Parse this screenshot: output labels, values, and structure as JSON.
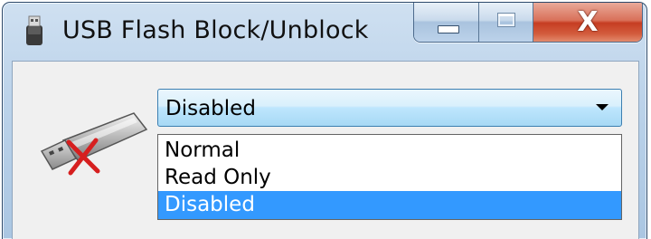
{
  "window": {
    "title": "USB Flash Block/Unblock",
    "controls": {
      "minimize_icon": "minimize-icon",
      "maximize_icon": "maximize-icon",
      "close_label": "X"
    }
  },
  "combo": {
    "selected_value": "Disabled",
    "options": [
      "Normal",
      "Read Only",
      "Disabled"
    ],
    "highlighted_option": "Disabled"
  },
  "colors": {
    "selection": "#3399ff",
    "close_button": "#c63d22",
    "combo_border": "#3c7fb1"
  },
  "icons": {
    "app": "usb-drive-icon",
    "usb_blocked": "usb-blocked-icon"
  }
}
